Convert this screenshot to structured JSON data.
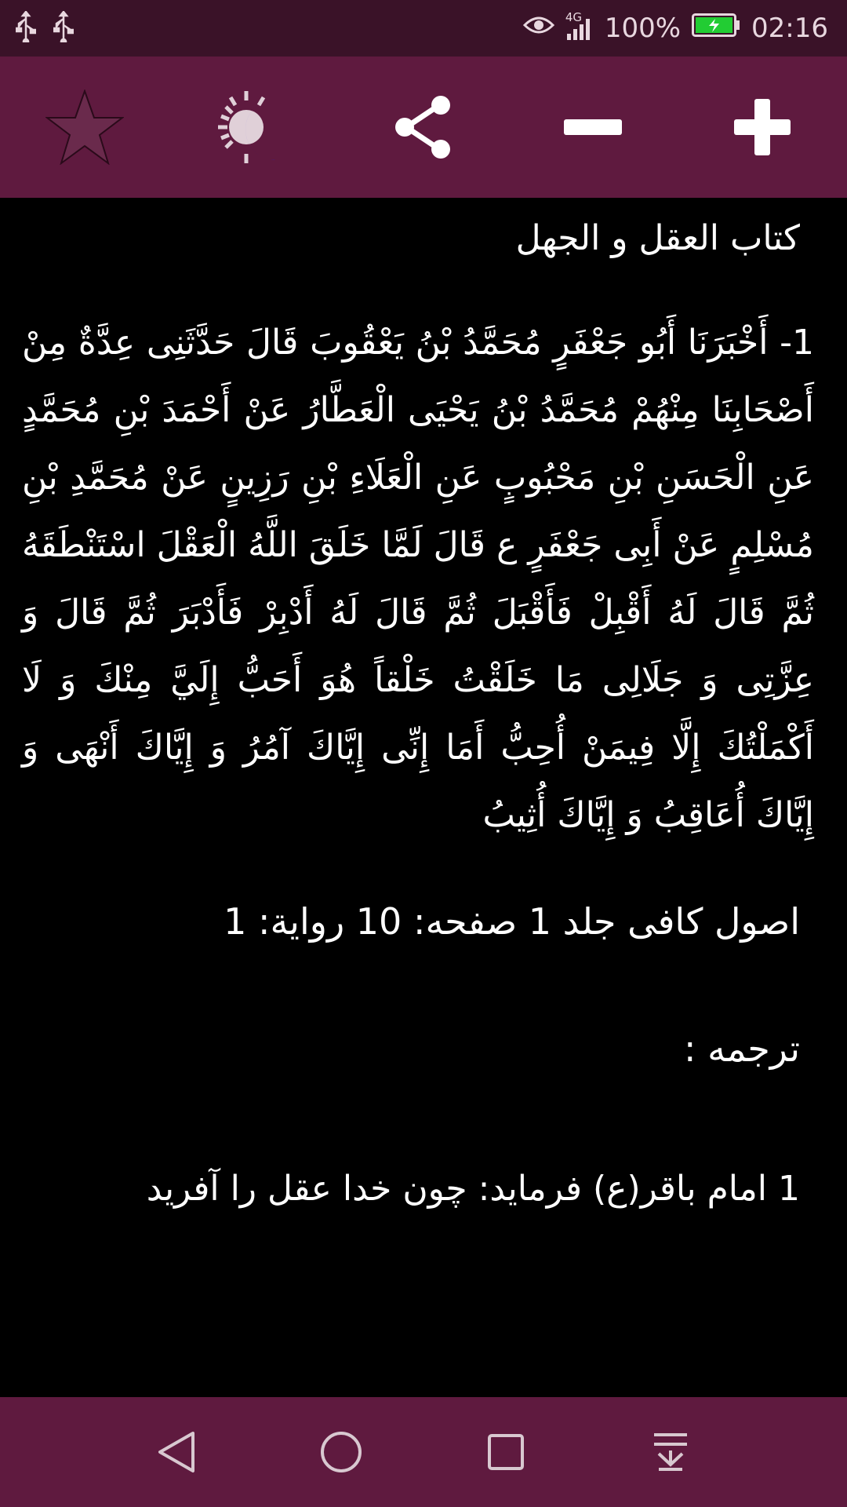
{
  "status_bar": {
    "network": "4G",
    "battery": "100%",
    "time": "02:16"
  },
  "toolbar": {
    "icons": [
      "star-icon",
      "day-night-icon",
      "share-icon",
      "minus-icon",
      "plus-icon"
    ]
  },
  "content": {
    "book_title": "کتاب العقل و الجهل",
    "hadith": "1- أَخْبَرَنَا أَبُو جَعْفَرٍ مُحَمَّدُ بْنُ يَعْقُوبَ قَالَ حَدَّثَنِی عِدَّةٌ مِنْ أَصْحَابِنَا مِنْهُمْ مُحَمَّدُ بْنُ يَحْيَی الْعَطَّارُ عَنْ أَحْمَدَ بْنِ مُحَمَّدٍ عَنِ الْحَسَنِ بْنِ مَحْبُوبٍ عَنِ الْعَلَاءِ بْنِ رَزِينٍ عَنْ مُحَمَّدِ بْنِ مُسْلِمٍ عَنْ أَبِی جَعْفَرٍ ع قَالَ لَمَّا خَلَقَ اللَّهُ الْعَقْلَ اسْتَنْطَقَهُ ثُمَّ قَالَ لَهُ أَقْبِلْ فَأَقْبَلَ ثُمَّ قَالَ لَهُ أَدْبِرْ فَأَدْبَرَ ثُمَّ قَالَ وَ عِزَّتِی وَ جَلَالِی مَا خَلَقْتُ خَلْقاً هُوَ أَحَبُّ إِلَيَّ مِنْكَ وَ لَا أَكْمَلْتُكَ إِلَّا فِيمَنْ أُحِبُّ أَمَا إِنِّی إِيَّاكَ آمُرُ وَ إِيَّاكَ أَنْهَی وَ إِيَّاكَ أُعَاقِبُ وَ إِيَّاكَ أُثِيبُ",
    "source": "اصول کافی جلد 1 صفحه: 10 رواية: 1",
    "translation_label": "ترجمه :",
    "translation": "1 امام باقر(ع) فرمايد: چون خدا عقل را آفريد"
  },
  "colors": {
    "status_bar_bg": "#3a1228",
    "toolbar_bg": "#5f1a3f",
    "content_bg": "#000000",
    "moon_blue": "#1a1aff"
  }
}
